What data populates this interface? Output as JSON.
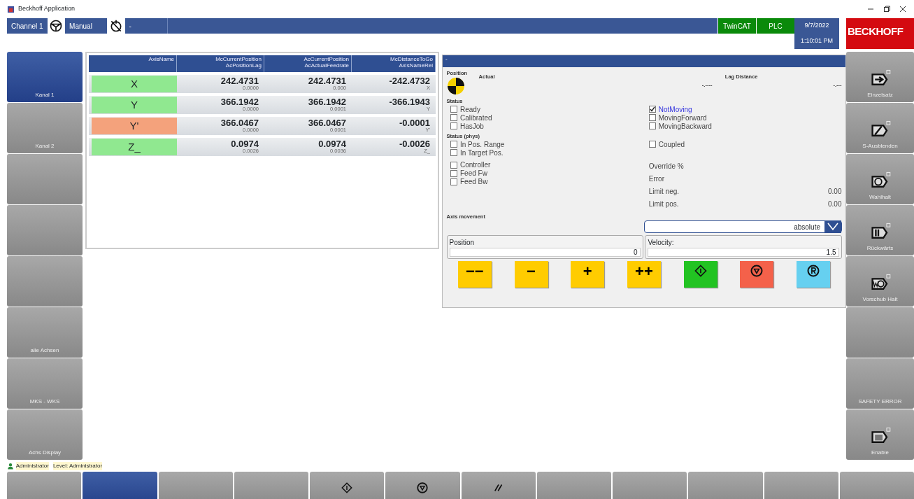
{
  "window": {
    "title": "Beckhoff Application"
  },
  "header": {
    "channel": "Channel 1",
    "mode": "Manual",
    "program": "-",
    "indicators": [
      {
        "label": "TwinCAT"
      },
      {
        "label": "PLC"
      }
    ],
    "date": "9/7/2022",
    "time": "1:10:01 PM",
    "logo": "BECKHOFF"
  },
  "left_buttons": [
    {
      "label": "Kanal 1",
      "selected": true
    },
    {
      "label": "Kanal 2",
      "selected": false
    },
    {
      "selected": false
    },
    {
      "selected": false
    },
    {
      "selected": false
    },
    {
      "label": "alle Achsen",
      "selected": false
    },
    {
      "label": "MKS - WKS",
      "selected": false
    },
    {
      "label": "Achs Display",
      "selected": false
    }
  ],
  "axis_table": {
    "columns": [
      {
        "title": "AxisName"
      },
      {
        "title": "McCurrentPosition",
        "subtitle": "AcPositionLag"
      },
      {
        "title": "AcCurrentPosition",
        "subtitle": "AcActualFeedrate"
      },
      {
        "title": "McDistanceToGo",
        "subtitle": "AxisNameRel"
      }
    ],
    "rows": [
      {
        "cells": [
          {
            "value": "X",
            "color": "#90e890"
          },
          {
            "value": "242.4731",
            "sub": "0.0000"
          },
          {
            "value": "242.4731",
            "sub": "0.000"
          },
          {
            "value": "-242.4732",
            "sub": "X"
          }
        ]
      },
      {
        "cells": [
          {
            "value": "Y",
            "color": "#90e890"
          },
          {
            "value": "366.1942",
            "sub": "0.0000"
          },
          {
            "value": "366.1942",
            "sub": "0.0001"
          },
          {
            "value": "-366.1943",
            "sub": "Y"
          }
        ]
      },
      {
        "cells": [
          {
            "value": "Y'",
            "color": "#f4a27c"
          },
          {
            "value": "366.0467",
            "sub": "0.0000"
          },
          {
            "value": "366.0467",
            "sub": "0.0001"
          },
          {
            "value": "-0.0001",
            "sub": "Y'"
          }
        ]
      },
      {
        "cells": [
          {
            "value": "Z_",
            "color": "#90e890"
          },
          {
            "value": "0.0974",
            "sub": "0.0026"
          },
          {
            "value": "0.0974",
            "sub": "0.0036"
          },
          {
            "value": "-0.0026",
            "sub": "Z_"
          }
        ]
      }
    ]
  },
  "detail": {
    "title": "-",
    "position_label": "Position",
    "actual_label": "Actual",
    "lag_label": "Lag Distance",
    "actual_value": "-.----",
    "lag_value": "-.---",
    "status_label": "Status",
    "status_left": [
      {
        "label": "Ready",
        "checked": false
      },
      {
        "label": "Calibrated",
        "checked": false
      },
      {
        "label": "HasJob",
        "checked": false
      }
    ],
    "status_right": [
      {
        "label": "NotMoving",
        "checked": true
      },
      {
        "label": "MovingForward",
        "checked": false
      },
      {
        "label": "MovingBackward",
        "checked": false
      }
    ],
    "phys_label": "Status (phys)",
    "phys_left": [
      {
        "label": "In Pos. Range",
        "checked": false
      },
      {
        "label": "In Target Pos.",
        "checked": false
      }
    ],
    "phys_right": [
      {
        "label": "Coupled",
        "checked": false
      }
    ],
    "drive_left": [
      {
        "label": "Controller",
        "checked": false
      },
      {
        "label": "Feed Fw",
        "checked": false
      },
      {
        "label": "Feed Bw",
        "checked": false
      }
    ],
    "values": [
      {
        "label": "Override %"
      },
      {
        "label": "Error"
      },
      {
        "label": "Limit neg.",
        "value": "0.00"
      },
      {
        "label": "Limit pos.",
        "value": "0.00"
      }
    ],
    "movement_label": "Axis movement",
    "movement_mode": "absolute",
    "position_field": {
      "label": "Position",
      "value": "0"
    },
    "velocity_field": {
      "label": "Velocity:",
      "value": "1.5"
    },
    "jog_buttons": [
      {
        "kind": "text",
        "label": "−−",
        "color": "#ffcc00"
      },
      {
        "kind": "text",
        "label": "−",
        "color": "#ffcc00"
      },
      {
        "kind": "text",
        "label": "+",
        "color": "#ffcc00"
      },
      {
        "kind": "text",
        "label": "++",
        "color": "#ffcc00"
      },
      {
        "kind": "start",
        "color": "#22c322"
      },
      {
        "kind": "stop",
        "color": "#f4614a"
      },
      {
        "kind": "reset",
        "color": "#66d0f0"
      }
    ]
  },
  "right_buttons": [
    {
      "label": "Einzelsatz",
      "kind": "single-block"
    },
    {
      "label": "S-Ausblenden",
      "kind": "skip"
    },
    {
      "label": "Wahlhalt",
      "kind": "optional-stop"
    },
    {
      "label": "Rückwärts",
      "kind": "reverse"
    },
    {
      "label": "Vorschub Halt",
      "kind": "feed-hold"
    },
    {
      "kind": "none"
    },
    {
      "label": "SAFETY ERROR",
      "kind": "none"
    },
    {
      "label": "Enable",
      "kind": "enable"
    }
  ],
  "status_bar": {
    "user": "Administrator",
    "level": "Level: Administrator"
  },
  "bottom_buttons": [
    {
      "kind": "none",
      "selected": false
    },
    {
      "kind": "none",
      "selected": true
    },
    {
      "kind": "none",
      "selected": false
    },
    {
      "kind": "none",
      "selected": false
    },
    {
      "kind": "start",
      "selected": false
    },
    {
      "kind": "stop",
      "selected": false
    },
    {
      "kind": "slash",
      "selected": false
    },
    {
      "kind": "none",
      "selected": false
    },
    {
      "kind": "none",
      "selected": false
    },
    {
      "kind": "none",
      "selected": false
    },
    {
      "kind": "none",
      "selected": false
    },
    {
      "kind": "none",
      "selected": false
    }
  ]
}
